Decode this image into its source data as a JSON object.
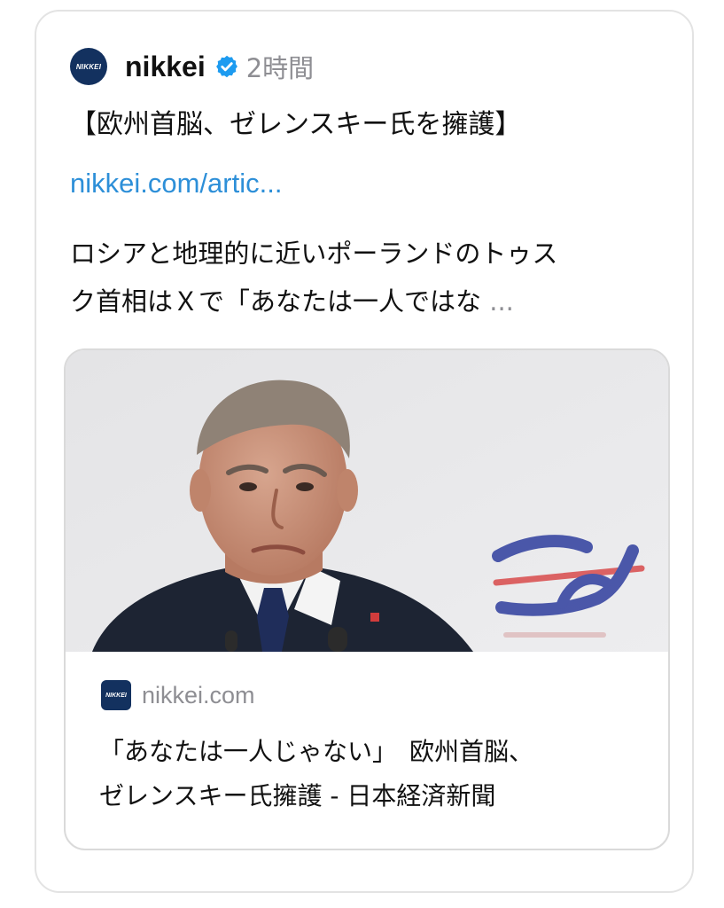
{
  "post": {
    "avatar_text": "NIKKEI",
    "account_name": "nikkei",
    "verified_icon": "verified-badge-icon",
    "time": "2時間",
    "headline": "【欧州首脳、ゼレンスキー氏を擁護】",
    "link": "nikkei.com/artic...",
    "body_lines": [
      "ロシアと地理的に近いポーランドのトゥス",
      "ク首相はＸで「あなたは一人ではな"
    ],
    "ellipsis": " ..."
  },
  "preview": {
    "favicon_text": "NIKKEI",
    "domain": "nikkei.com",
    "title_lines": [
      "「あなたは一人じゃない」　欧州首脳、",
      "ゼレンスキー氏擁護 - 日本経済新聞"
    ]
  },
  "colors": {
    "brand_navy": "#13315f",
    "link_blue": "#2d8fd8",
    "verified_blue": "#1d9bf0",
    "muted_gray": "#8e8e93"
  }
}
